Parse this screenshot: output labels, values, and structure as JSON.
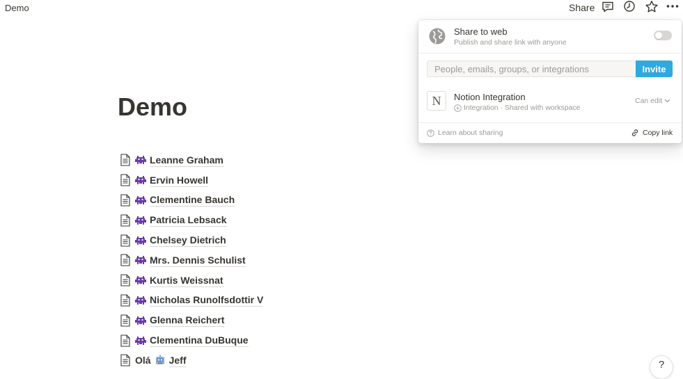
{
  "topbar": {
    "breadcrumb": "Demo",
    "share_label": "Share",
    "icons": [
      "comment-icon",
      "clock-icon",
      "star-icon",
      "more-icon"
    ]
  },
  "page": {
    "title": "Demo",
    "items": [
      {
        "label": "Leanne Graham",
        "icon": "alien-monster-emoji"
      },
      {
        "label": "Ervin Howell",
        "icon": "alien-monster-emoji"
      },
      {
        "label": "Clementine Bauch",
        "icon": "alien-monster-emoji"
      },
      {
        "label": "Patricia Lebsack",
        "icon": "alien-monster-emoji"
      },
      {
        "label": "Chelsey Dietrich",
        "icon": "alien-monster-emoji"
      },
      {
        "label": "Mrs. Dennis Schulist",
        "icon": "alien-monster-emoji"
      },
      {
        "label": "Kurtis Weissnat",
        "icon": "alien-monster-emoji"
      },
      {
        "label": "Nicholas Runolfsdottir V",
        "icon": "alien-monster-emoji"
      },
      {
        "label": "Glenna Reichert",
        "icon": "alien-monster-emoji"
      },
      {
        "label": "Clementina DuBuque",
        "icon": "alien-monster-emoji"
      }
    ],
    "last_item": {
      "prefix": "Olá",
      "label": "Jeff",
      "icon": "robot-emoji"
    }
  },
  "share_popover": {
    "web_title": "Share to web",
    "web_subtitle": "Publish and share link with anyone",
    "web_enabled": false,
    "invite_placeholder": "People, emails, groups, or integrations",
    "invite_label": "Invite",
    "integration": {
      "icon_letter": "N",
      "name": "Notion Integration",
      "subtitle": "Integration · Shared with workspace",
      "permission": "Can edit"
    },
    "learn_label": "Learn about sharing",
    "copy_label": "Copy link"
  },
  "help_label": "?",
  "colors": {
    "accent": "#2eaadc",
    "text": "#37352f",
    "muted": "#9b9a97",
    "emoji_purple": "#6a3aa8"
  }
}
